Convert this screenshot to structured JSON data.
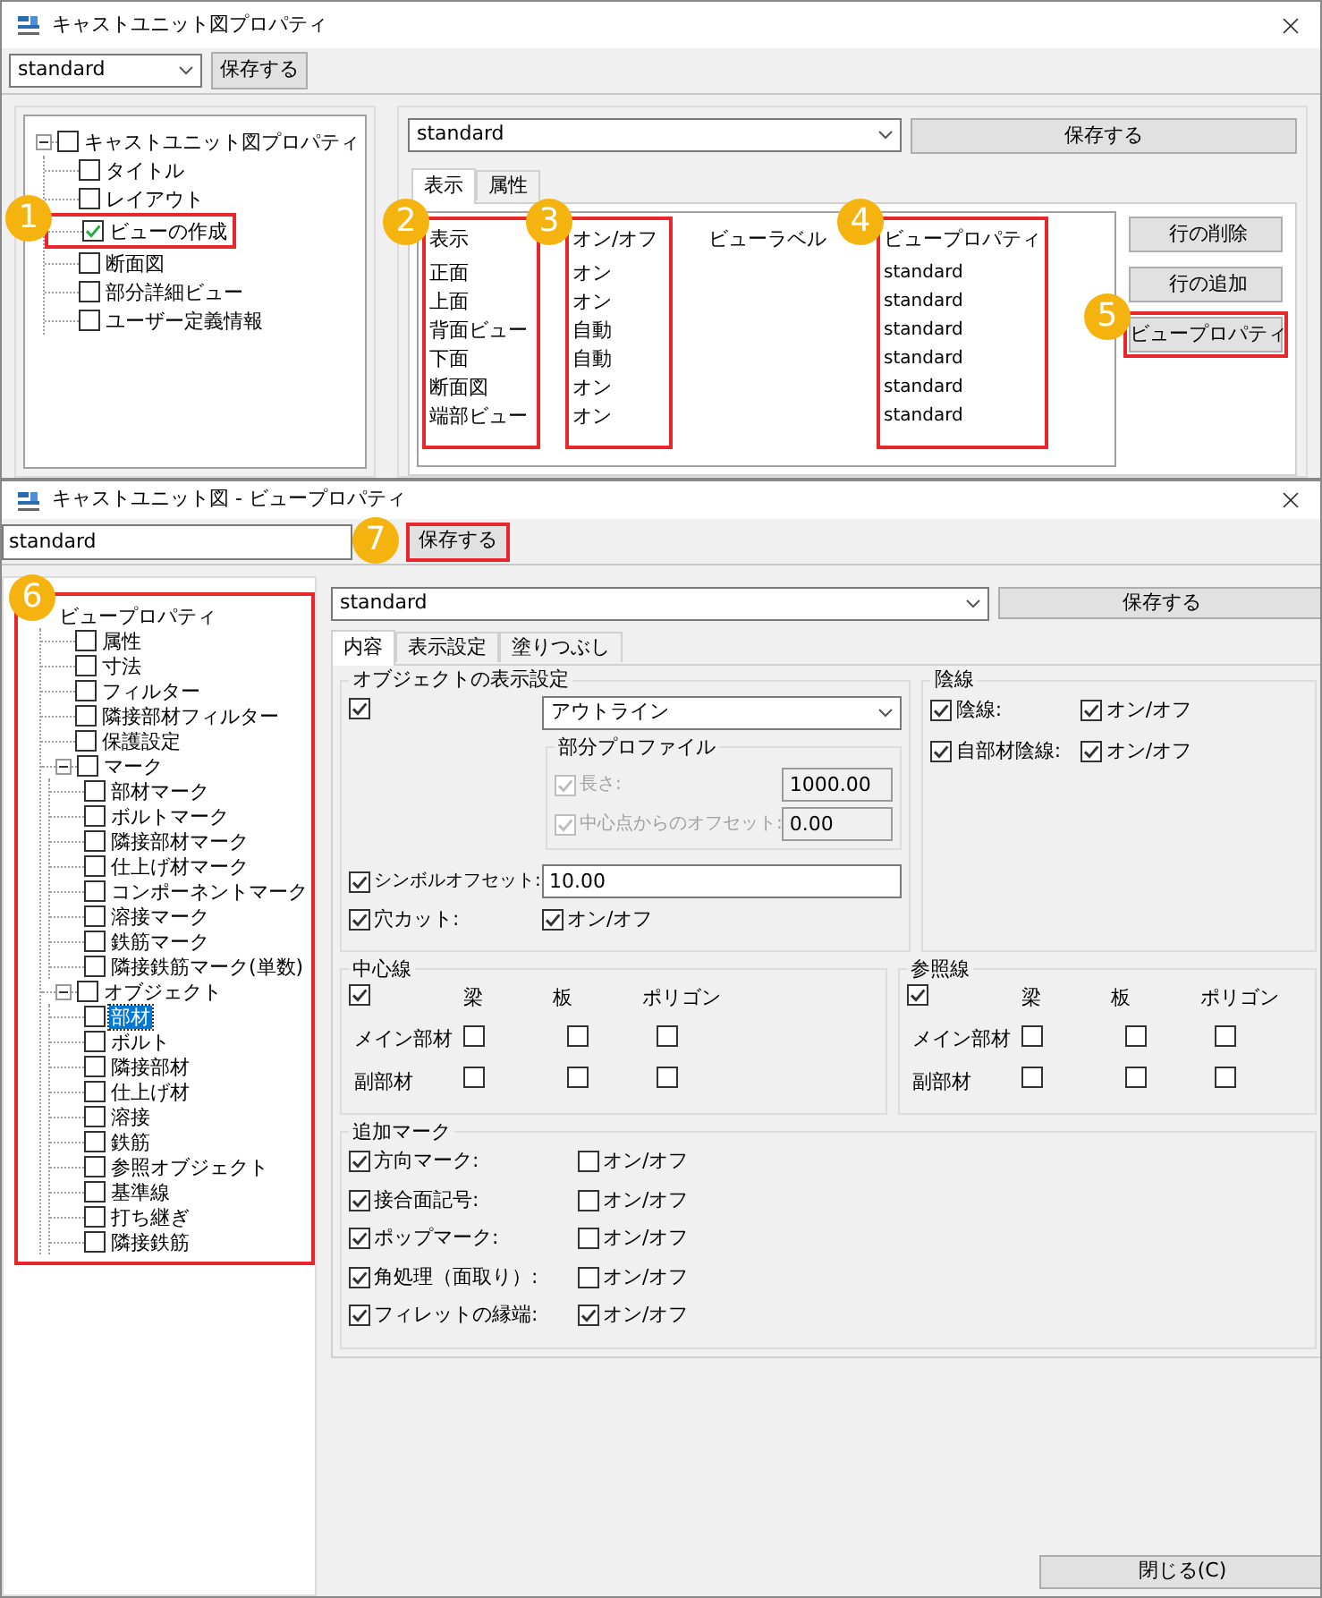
{
  "main_window": {
    "title": "キャストユニット図プロパティ",
    "toolbar": {
      "preset": "standard",
      "save_button": "保存する"
    },
    "tree": {
      "label": "キャストユニット図プロパティ",
      "checked": false,
      "expanded": true,
      "children": [
        {
          "label": "タイトル",
          "checked": false
        },
        {
          "label": "レイアウト",
          "checked": false
        },
        {
          "label": "ビューの作成",
          "checked": true,
          "highlighted": true,
          "callout": "1"
        },
        {
          "label": "断面図",
          "checked": false
        },
        {
          "label": "部分詳細ビュー",
          "checked": false
        },
        {
          "label": "ユーザー定義情報",
          "checked": false
        }
      ]
    },
    "view_preset": "standard",
    "save_button": "保存する",
    "tabs": [
      {
        "label": "表示",
        "selected": true
      },
      {
        "label": "属性",
        "selected": false
      }
    ],
    "table": {
      "columns": [
        {
          "header": "表示",
          "highlighted": true,
          "callout": "2"
        },
        {
          "header": "オン/オフ",
          "highlighted": true,
          "callout": "3"
        },
        {
          "header": "ビューラベル",
          "highlighted": false
        },
        {
          "header": "ビュープロパティ",
          "highlighted": true,
          "callout": "4"
        }
      ],
      "rows": [
        {
          "view": "正面",
          "on_off": "オン",
          "view_property": "standard"
        },
        {
          "view": "上面",
          "on_off": "オン",
          "view_property": "standard"
        },
        {
          "view": "背面ビュー",
          "on_off": "自動",
          "view_property": "standard"
        },
        {
          "view": "下面",
          "on_off": "自動",
          "view_property": "standard"
        },
        {
          "view": "断面図",
          "on_off": "オン",
          "view_property": "standard"
        },
        {
          "view": "端部ビュー",
          "on_off": "オン",
          "view_property": "standard"
        }
      ]
    },
    "row_buttons": [
      {
        "label": "行の削除",
        "highlighted": false
      },
      {
        "label": "行の追加",
        "highlighted": false
      },
      {
        "label": "ビュープロパティ",
        "highlighted": true,
        "callout": "5"
      }
    ]
  },
  "view_properties_window": {
    "title": "キャストユニット図 - ビュープロパティ",
    "name_field": "standard",
    "save_button": {
      "label": "保存する",
      "highlighted": true,
      "callout": "7"
    },
    "tree": {
      "highlighted": true,
      "callout": "6",
      "root": {
        "label": "ビュープロパティ",
        "children": [
          {
            "label": "属性",
            "checked": false,
            "selected": false
          },
          {
            "label": "寸法",
            "checked": false,
            "selected": false
          },
          {
            "label": "フィルター",
            "checked": false,
            "selected": false
          },
          {
            "label": "隣接部材フィルター",
            "checked": false,
            "selected": false
          },
          {
            "label": "保護設定",
            "checked": false,
            "selected": false
          },
          {
            "label": "マーク",
            "checked": false,
            "selected": false,
            "expanded": true,
            "children": [
              {
                "label": "部材マーク",
                "checked": false,
                "selected": false
              },
              {
                "label": "ボルトマーク",
                "checked": false,
                "selected": false
              },
              {
                "label": "隣接部材マーク",
                "checked": false,
                "selected": false
              },
              {
                "label": "仕上げ材マーク",
                "checked": false,
                "selected": false
              },
              {
                "label": "コンポーネントマーク",
                "checked": false,
                "selected": false
              },
              {
                "label": "溶接マーク",
                "checked": false,
                "selected": false
              },
              {
                "label": "鉄筋マーク",
                "checked": false,
                "selected": false
              },
              {
                "label": "隣接鉄筋マーク(単数)",
                "checked": false,
                "selected": false
              }
            ]
          },
          {
            "label": "オブジェクト",
            "checked": false,
            "selected": false,
            "expanded": true,
            "children": [
              {
                "label": "部材",
                "checked": false,
                "selected": true
              },
              {
                "label": "ボルト",
                "checked": false,
                "selected": false
              },
              {
                "label": "隣接部材",
                "checked": false,
                "selected": false
              },
              {
                "label": "仕上げ材",
                "checked": false,
                "selected": false
              },
              {
                "label": "溶接",
                "checked": false,
                "selected": false
              },
              {
                "label": "鉄筋",
                "checked": false,
                "selected": false
              },
              {
                "label": "参照オブジェクト",
                "checked": false,
                "selected": false
              },
              {
                "label": "基準線",
                "checked": false,
                "selected": false
              },
              {
                "label": "打ち継ぎ",
                "checked": false,
                "selected": false
              },
              {
                "label": "隣接鉄筋",
                "checked": false,
                "selected": false
              }
            ]
          }
        ]
      }
    },
    "preset": "standard",
    "preset_save_button": "保存する",
    "tabs": [
      {
        "label": "内容",
        "selected": true
      },
      {
        "label": "表示設定",
        "selected": false
      },
      {
        "label": "塗りつぶし",
        "selected": false
      }
    ],
    "object_display": {
      "title": "オブジェクトの表示設定",
      "checked": true,
      "mode": "アウトライン",
      "partial_profile": {
        "title": "部分プロファイル",
        "rows": [
          {
            "label": "長さ:",
            "checked": true,
            "disabled": true,
            "value": "1000.00"
          },
          {
            "label": "中心点からのオフセット:",
            "checked": true,
            "disabled": true,
            "value": "0.00"
          }
        ]
      },
      "symbol_offset": {
        "label": "シンボルオフセット:",
        "checked": true,
        "value": "10.00"
      },
      "hole_cut": {
        "label": "穴カット:",
        "checked": true,
        "toggle_label": "オン/オフ",
        "toggle_checked": true
      }
    },
    "hidden_lines": {
      "title": "陰線",
      "rows": [
        {
          "label": "陰線:",
          "checked": true,
          "toggle_label": "オン/オフ",
          "toggle_checked": true
        },
        {
          "label": "自部材陰線:",
          "checked": true,
          "toggle_label": "オン/オフ",
          "toggle_checked": true
        }
      ]
    },
    "center_lines": {
      "title": "中心線",
      "checked": true,
      "columns": [
        "梁",
        "板",
        "ポリゴン"
      ],
      "rows": [
        {
          "label": "メイン部材",
          "checks": [
            false,
            false,
            false
          ]
        },
        {
          "label": "副部材",
          "checks": [
            false,
            false,
            false
          ]
        }
      ]
    },
    "reference_lines": {
      "title": "参照線",
      "checked": true,
      "columns": [
        "梁",
        "板",
        "ポリゴン"
      ],
      "rows": [
        {
          "label": "メイン部材",
          "checks": [
            false,
            false,
            false
          ]
        },
        {
          "label": "副部材",
          "checks": [
            false,
            false,
            false
          ]
        }
      ]
    },
    "additional_marks": {
      "title": "追加マーク",
      "rows": [
        {
          "label": "方向マーク:",
          "checked": true,
          "toggle_label": "オン/オフ",
          "toggle_checked": false
        },
        {
          "label": "接合面記号:",
          "checked": true,
          "toggle_label": "オン/オフ",
          "toggle_checked": false
        },
        {
          "label": "ポップマーク:",
          "checked": true,
          "toggle_label": "オン/オフ",
          "toggle_checked": false
        },
        {
          "label": "角処理（面取り）:",
          "checked": true,
          "toggle_label": "オン/オフ",
          "toggle_checked": false
        },
        {
          "label": "フィレットの縁端:",
          "checked": true,
          "toggle_label": "オン/オフ",
          "toggle_checked": true
        }
      ]
    },
    "close_button": "閉じる(C)"
  }
}
